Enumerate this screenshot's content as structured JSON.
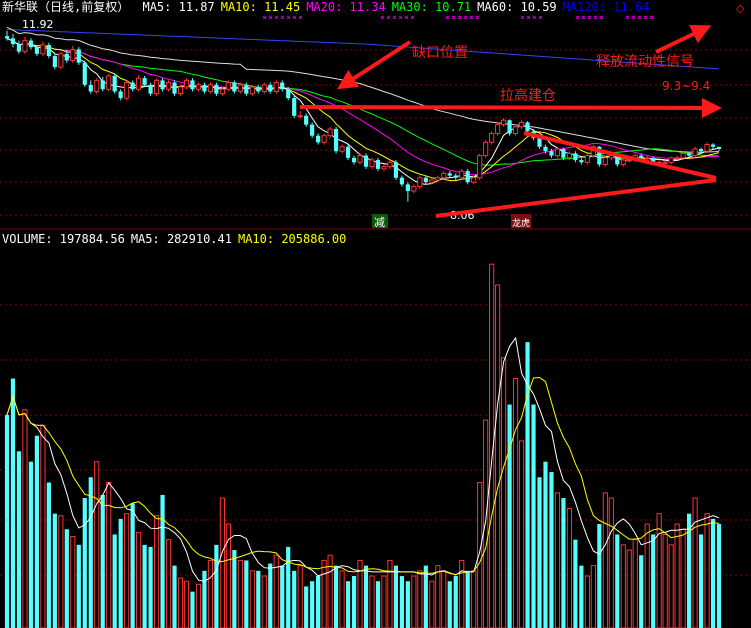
{
  "price_header": {
    "title": "新华联（日线,前复权）",
    "items": [
      {
        "label": "MA5:",
        "value": "11.87",
        "color": "#ffffff"
      },
      {
        "label": "MA10:",
        "value": "11.45",
        "color": "#ffff00"
      },
      {
        "label": "MA20:",
        "value": "11.34",
        "color": "#ff00ff"
      },
      {
        "label": "MA30:",
        "value": "10.71",
        "color": "#00ff00"
      },
      {
        "label": "MA60:",
        "value": "10.59",
        "color": "#ffffff"
      },
      {
        "label": "MA120:",
        "value": "11.64",
        "color": "#0000ff"
      }
    ]
  },
  "volume_header": {
    "items": [
      {
        "label": "VOLUME:",
        "value": "197884.56",
        "color": "#ffffff"
      },
      {
        "label": "MA5:",
        "value": "282910.41",
        "color": "#ffffff"
      },
      {
        "label": "MA10:",
        "value": "205886.00",
        "color": "#ffff00"
      }
    ]
  },
  "annotations": {
    "gap_label": "缺口位置",
    "raise_label": "拉高建仓",
    "release_label": "释放流动性信号",
    "range_label": "9.3~9.4",
    "high_label": "11.92",
    "low_label": "8.06",
    "badge_reduce": "减",
    "badge_dragon": "龙虎"
  },
  "colors": {
    "up": "#ff3232",
    "down": "#54ffff",
    "arrow": "#ff1a1a",
    "ma5": "#ffffff",
    "ma10": "#ffff00",
    "ma20": "#ff00ff",
    "ma30": "#00ff00",
    "ma60": "#dddddd",
    "ma120": "#3344ff",
    "grid": "#8b0000"
  },
  "chart_data": {
    "type": "candlestick",
    "x": [
      1,
      2,
      3,
      4,
      5,
      6,
      7,
      8,
      9,
      10,
      11,
      12,
      13,
      14,
      15,
      16,
      17,
      18,
      19,
      20,
      21,
      22,
      23,
      24,
      25,
      26,
      27,
      28,
      29,
      30,
      31,
      32,
      33,
      34,
      35,
      36,
      37,
      38,
      39,
      40,
      41,
      42,
      43,
      44,
      45,
      46,
      47,
      48,
      49,
      50,
      51,
      52,
      53,
      54,
      55,
      56,
      57,
      58,
      59,
      60,
      61,
      62,
      63,
      64,
      65,
      66,
      67,
      68,
      69,
      70,
      71,
      72,
      73,
      74,
      75,
      76,
      77,
      78,
      79,
      80,
      81,
      82,
      83,
      84,
      85,
      86,
      87,
      88,
      89,
      90,
      91,
      92,
      93,
      94,
      95,
      96,
      97,
      98,
      99,
      100,
      101,
      102,
      103,
      104,
      105,
      106,
      107,
      108,
      109,
      110,
      111,
      112,
      113,
      114,
      115,
      116,
      117,
      118,
      119,
      120
    ],
    "series": [
      {
        "open": [
          11.8,
          11.75,
          11.62,
          11.45,
          11.7,
          11.55,
          11.4,
          11.6,
          11.35,
          11.1,
          11.4,
          11.25,
          11.5,
          11.2,
          10.7,
          10.55,
          10.8,
          10.6,
          10.9,
          10.55,
          10.4,
          10.75,
          10.6,
          10.85,
          10.7,
          10.5,
          10.8,
          10.6,
          10.75,
          10.5,
          10.65,
          10.8,
          10.6,
          10.7,
          10.55,
          10.7,
          10.5,
          10.6,
          10.75,
          10.55,
          10.7,
          10.5,
          10.65,
          10.55,
          10.7,
          10.55,
          10.75,
          10.6,
          10.4,
          10.0,
          10.0,
          9.8,
          9.55,
          9.4,
          9.55,
          9.7,
          9.2,
          9.3,
          9.05,
          8.95,
          9.1,
          8.85,
          9.0,
          8.8,
          8.85,
          8.95,
          8.6,
          8.45,
          8.3,
          8.4,
          8.6,
          8.5,
          8.55,
          8.6,
          8.7,
          8.65,
          8.6,
          8.75,
          8.5,
          8.6,
          9.1,
          9.4,
          9.6,
          9.8,
          9.9,
          9.6,
          9.75,
          9.85,
          9.65,
          9.5,
          9.3,
          9.2,
          9.1,
          9.25,
          9.05,
          9.15,
          9.0,
          8.95,
          9.1,
          9.3,
          8.9,
          9.05,
          9.1,
          8.9,
          9.0,
          9.0,
          9.1,
          9.05,
          9.05,
          8.95,
          8.95,
          8.95,
          9.05,
          9.05,
          9.15,
          9.1,
          9.25,
          9.2,
          9.35,
          9.3
        ],
        "close": [
          11.75,
          11.62,
          11.45,
          11.7,
          11.55,
          11.4,
          11.6,
          11.35,
          11.1,
          11.4,
          11.25,
          11.5,
          11.2,
          10.7,
          10.55,
          10.8,
          10.6,
          10.9,
          10.55,
          10.4,
          10.75,
          10.6,
          10.85,
          10.7,
          10.5,
          10.8,
          10.6,
          10.75,
          10.5,
          10.65,
          10.8,
          10.6,
          10.7,
          10.55,
          10.7,
          10.5,
          10.6,
          10.75,
          10.55,
          10.7,
          10.5,
          10.65,
          10.55,
          10.7,
          10.55,
          10.75,
          10.6,
          10.4,
          10.0,
          10.0,
          9.8,
          9.55,
          9.4,
          9.55,
          9.7,
          9.2,
          9.3,
          9.05,
          8.95,
          9.1,
          8.85,
          9.0,
          8.8,
          8.85,
          8.95,
          8.6,
          8.45,
          8.3,
          8.4,
          8.6,
          8.5,
          8.55,
          8.6,
          8.7,
          8.65,
          8.6,
          8.75,
          8.5,
          8.6,
          9.1,
          9.4,
          9.6,
          9.8,
          9.9,
          9.6,
          9.75,
          9.85,
          9.65,
          9.5,
          9.3,
          9.2,
          9.1,
          9.25,
          9.05,
          9.15,
          9.0,
          8.95,
          9.1,
          9.3,
          8.9,
          9.05,
          9.1,
          8.9,
          9.0,
          9.0,
          9.1,
          9.05,
          9.05,
          8.95,
          8.95,
          8.95,
          9.05,
          9.05,
          9.15,
          9.1,
          9.25,
          9.2,
          9.35,
          9.3,
          9.25
        ],
        "high": [
          11.92,
          11.85,
          11.7,
          11.78,
          11.75,
          11.6,
          11.68,
          11.65,
          11.4,
          11.45,
          11.5,
          11.58,
          11.55,
          11.25,
          10.8,
          10.85,
          10.88,
          10.95,
          10.95,
          10.6,
          10.8,
          10.8,
          10.92,
          10.9,
          10.75,
          10.85,
          10.85,
          10.8,
          10.8,
          10.7,
          10.85,
          10.85,
          10.75,
          10.75,
          10.75,
          10.75,
          10.65,
          10.8,
          10.8,
          10.75,
          10.75,
          10.7,
          10.7,
          10.75,
          10.75,
          10.8,
          10.8,
          10.65,
          10.45,
          10.1,
          10.05,
          9.85,
          9.6,
          9.6,
          9.75,
          9.75,
          9.35,
          9.35,
          9.1,
          9.15,
          9.15,
          9.05,
          9.05,
          8.9,
          9.0,
          9.0,
          8.65,
          8.5,
          8.45,
          8.65,
          8.65,
          8.6,
          8.65,
          8.75,
          8.75,
          8.7,
          8.8,
          8.8,
          8.65,
          9.15,
          9.45,
          9.65,
          9.85,
          9.95,
          9.92,
          9.8,
          9.9,
          9.88,
          9.7,
          9.55,
          9.35,
          9.25,
          9.3,
          9.28,
          9.2,
          9.2,
          9.05,
          9.15,
          9.35,
          9.32,
          9.1,
          9.15,
          9.15,
          9.05,
          9.05,
          9.15,
          9.15,
          9.1,
          9.08,
          9.0,
          9.0,
          9.08,
          9.1,
          9.2,
          9.18,
          9.3,
          9.28,
          9.4,
          9.38,
          9.3
        ],
        "low": [
          11.7,
          11.55,
          11.4,
          11.4,
          11.5,
          11.35,
          11.35,
          11.3,
          11.05,
          11.05,
          11.2,
          11.2,
          11.15,
          10.65,
          10.5,
          10.5,
          10.55,
          10.55,
          10.5,
          10.35,
          10.35,
          10.55,
          10.55,
          10.65,
          10.45,
          10.45,
          10.55,
          10.55,
          10.45,
          10.45,
          10.6,
          10.55,
          10.55,
          10.5,
          10.5,
          10.45,
          10.45,
          10.55,
          10.5,
          10.5,
          10.45,
          10.45,
          10.5,
          10.5,
          10.5,
          10.5,
          10.55,
          10.35,
          9.95,
          9.95,
          9.75,
          9.5,
          9.35,
          9.35,
          9.5,
          9.15,
          9.15,
          9.0,
          8.9,
          8.9,
          8.8,
          8.8,
          8.75,
          8.75,
          8.8,
          8.55,
          8.4,
          8.06,
          8.25,
          8.35,
          8.45,
          8.45,
          8.5,
          8.55,
          8.6,
          8.55,
          8.55,
          8.45,
          8.45,
          8.55,
          9.05,
          9.35,
          9.55,
          9.75,
          9.55,
          9.55,
          9.7,
          9.6,
          9.45,
          9.25,
          9.15,
          9.05,
          9.05,
          9.0,
          9.0,
          8.95,
          8.9,
          8.9,
          9.05,
          8.85,
          8.85,
          9.0,
          8.85,
          8.85,
          8.95,
          8.95,
          9.0,
          9.0,
          8.9,
          8.9,
          8.9,
          8.9,
          9.0,
          9.0,
          9.05,
          9.05,
          9.15,
          9.15,
          9.25,
          9.2
        ]
      }
    ],
    "volume": [
      20.5,
      24.0,
      17.0,
      21.0,
      16.0,
      18.5,
      19.5,
      14.0,
      11.0,
      10.8,
      9.5,
      8.8,
      8.0,
      12.5,
      14.5,
      16.0,
      12.8,
      14.0,
      9.0,
      10.5,
      11.0,
      12.0,
      9.2,
      8.0,
      7.8,
      10.8,
      12.8,
      8.5,
      6.0,
      4.8,
      4.5,
      3.5,
      4.2,
      5.5,
      6.5,
      8.0,
      12.5,
      10.0,
      7.5,
      6.5,
      6.5,
      5.5,
      5.5,
      5.0,
      6.2,
      7.0,
      6.0,
      7.8,
      5.5,
      6.0,
      4.0,
      4.5,
      5.0,
      6.5,
      7.0,
      6.0,
      5.5,
      4.5,
      5.0,
      6.5,
      6.0,
      5.0,
      4.5,
      5.0,
      6.5,
      6.0,
      5.0,
      4.5,
      5.0,
      5.5,
      6.0,
      4.5,
      6.0,
      5.5,
      4.5,
      5.0,
      6.5,
      5.5,
      5.5,
      14.0,
      20.0,
      35.0,
      33.0,
      26.0,
      21.5,
      24.0,
      18.0,
      27.5,
      21.5,
      14.5,
      16.0,
      15.0,
      13.0,
      12.5,
      11.5,
      8.5,
      6.0,
      5.0,
      6.0,
      10.0,
      13.0,
      12.5,
      9.0,
      8.0,
      7.5,
      8.5,
      7.0,
      10.0,
      9.0,
      11.0,
      9.0,
      8.0,
      10.0,
      9.5,
      11.0,
      12.5,
      9.0,
      11.0,
      10.5,
      10.0
    ],
    "ylim": [
      7.6,
      12.3
    ]
  }
}
